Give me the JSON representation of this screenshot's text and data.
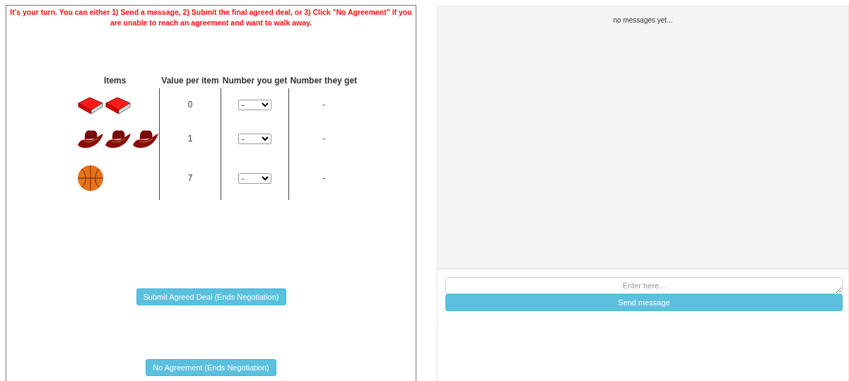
{
  "instruction": "It's your turn. You can either 1) Send a message, 2) Submit the final agreed deal, or 3) Click \"No Agreement\" if you are unable to reach an agreement and want to walk away.",
  "table": {
    "columns": [
      "Items",
      "Value per item",
      "Number you get",
      "Number they get"
    ],
    "rows": [
      {
        "items": [
          {
            "kind": "book"
          },
          {
            "kind": "book"
          }
        ],
        "value": "0",
        "you_get": "-",
        "they_get": "-"
      },
      {
        "items": [
          {
            "kind": "hat"
          },
          {
            "kind": "hat"
          },
          {
            "kind": "hat"
          }
        ],
        "value": "1",
        "you_get": "-",
        "they_get": "-"
      },
      {
        "items": [
          {
            "kind": "ball"
          }
        ],
        "value": "7",
        "you_get": "-",
        "they_get": "-"
      }
    ]
  },
  "buttons": {
    "submit": "Submit Agreed Deal (Ends Negotiation)",
    "no_agreement": "No Agreement (Ends Negotiation)"
  },
  "chat": {
    "empty_text": "no messages yet...",
    "placeholder": "Enter here...",
    "send": "Send message"
  }
}
